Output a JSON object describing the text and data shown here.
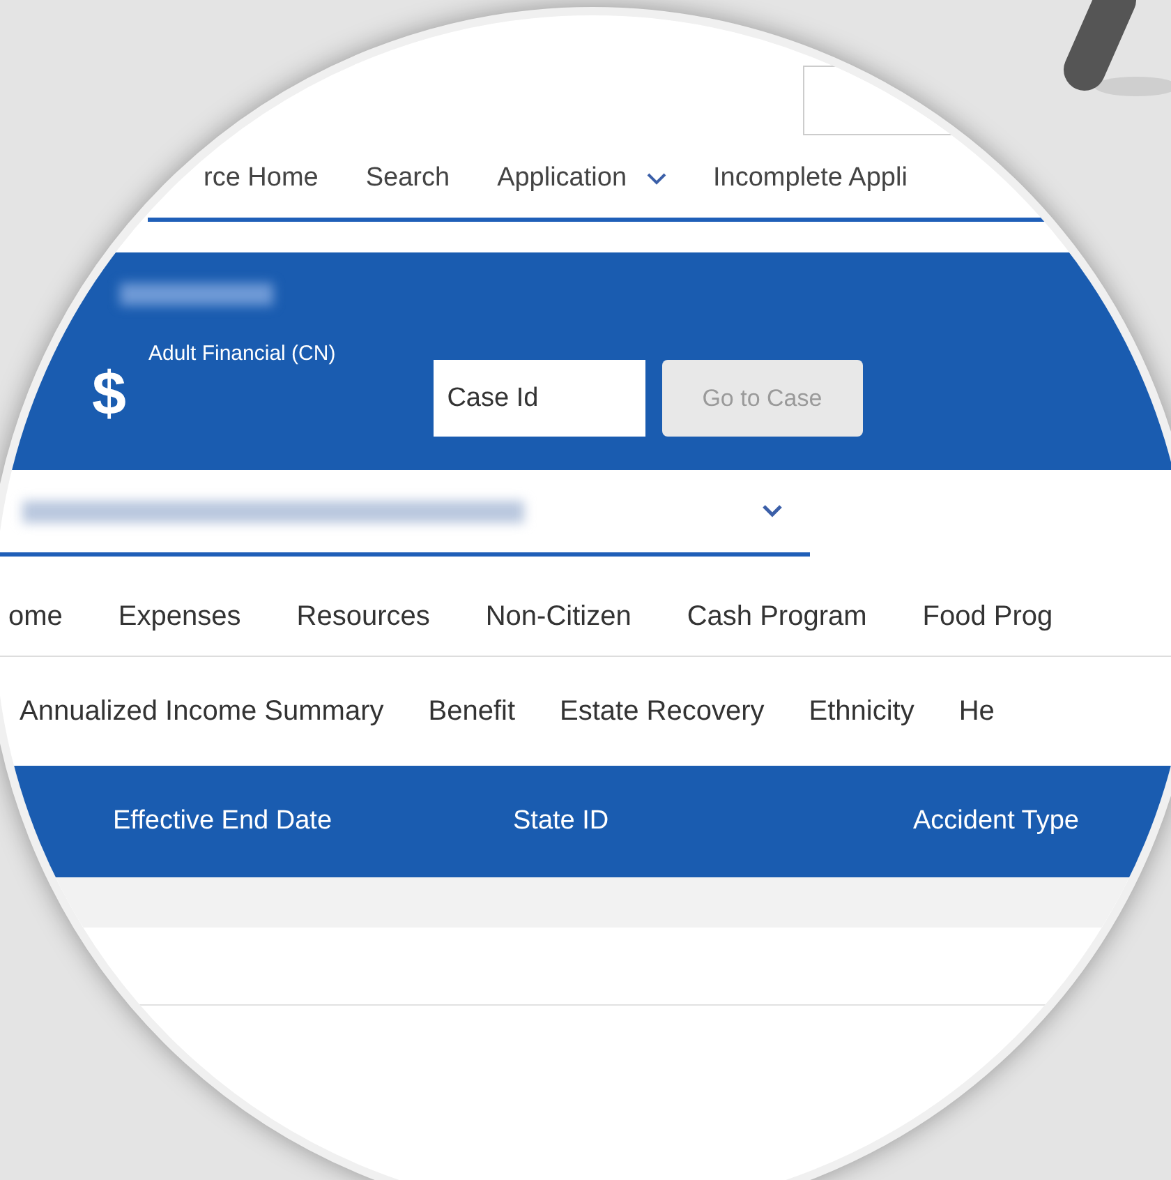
{
  "nav": [
    {
      "label": "rce Home",
      "dropdown": false
    },
    {
      "label": "Search",
      "dropdown": false
    },
    {
      "label": "Application",
      "dropdown": true
    },
    {
      "label": "Incomplete Appli",
      "dropdown": false
    }
  ],
  "header": {
    "icon_char": "$",
    "program": "Adult Financial (CN)",
    "case_field": {
      "placeholder": "Case Id"
    },
    "go_button": {
      "label": "Go to Case",
      "disabled": true
    }
  },
  "tabs": [
    "ome",
    "Expenses",
    "Resources",
    "Non-Citizen",
    "Cash Program",
    "Food Prog"
  ],
  "subtabs": [
    "Annualized Income Summary",
    "Benefit",
    "Estate Recovery",
    "Ethnicity",
    "He"
  ],
  "table": {
    "columns": [
      "Effective End Date",
      "State ID",
      "Accident Type"
    ]
  }
}
